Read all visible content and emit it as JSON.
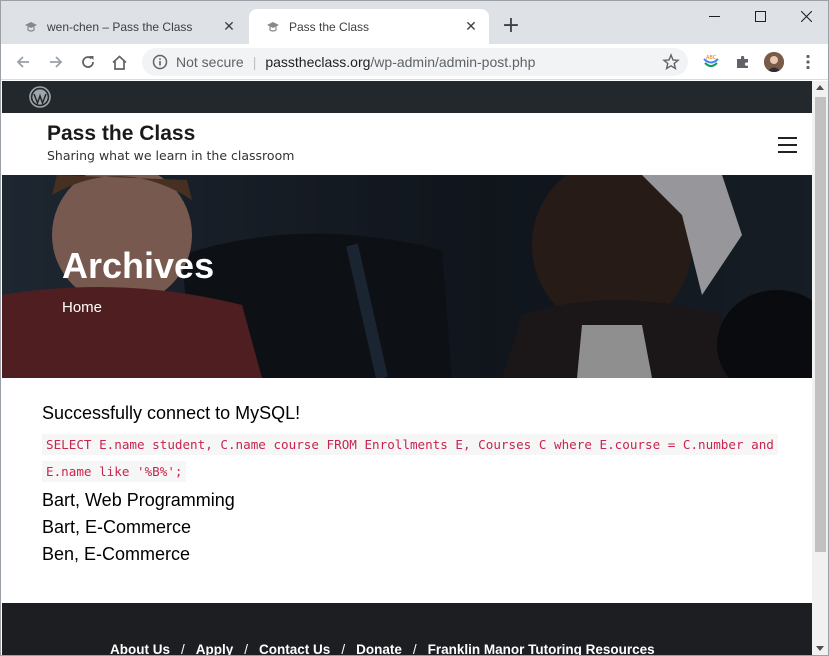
{
  "browser": {
    "tabs": [
      {
        "title": "wen-chen – Pass the Class",
        "active": false
      },
      {
        "title": "Pass the Class",
        "active": true
      }
    ],
    "omnibox": {
      "security": "Not secure",
      "host": "passtheclass.org",
      "path": "/wp-admin/admin-post.php"
    }
  },
  "site": {
    "title": "Pass the Class",
    "tagline": "Sharing what we learn in the classroom"
  },
  "hero": {
    "title": "Archives",
    "breadcrumb": "Home"
  },
  "content": {
    "status": "Successfully connect to MySQL!",
    "query": "SELECT E.name student, C.name course FROM Enrollments E, Courses C where E.course = C.number and E.name like '%B%';",
    "results": [
      "Bart, Web Programming",
      "Bart, E-Commerce",
      "Ben, E-Commerce"
    ]
  },
  "footer": {
    "links": [
      "About Us",
      "Apply",
      "Contact Us",
      "Donate",
      "Franklin Manor Tutoring Resources"
    ]
  },
  "colors": {
    "admin_bar": "#23282d",
    "code_text": "#c7254e",
    "footer_bg": "#1c1e21"
  }
}
